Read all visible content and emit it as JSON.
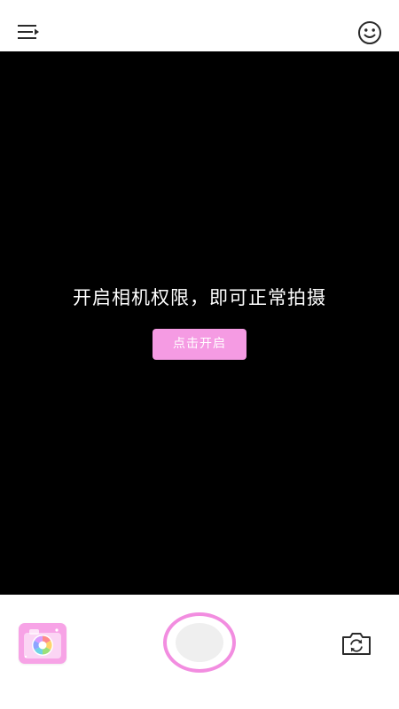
{
  "header": {
    "menu_icon": "menu-lines-icon",
    "profile_icon": "smiley-face-icon"
  },
  "camera": {
    "permission_message": "开启相机权限，即可正常拍摄",
    "enable_button_label": "点击开启"
  },
  "footer": {
    "gallery_icon": "camera-album-icon",
    "shutter_icon": "shutter-icon",
    "flip_icon": "switch-camera-icon"
  },
  "colors": {
    "accent_pink": "#f59be3",
    "shutter_ring": "#f28de0",
    "viewfinder_bg": "#000000"
  }
}
